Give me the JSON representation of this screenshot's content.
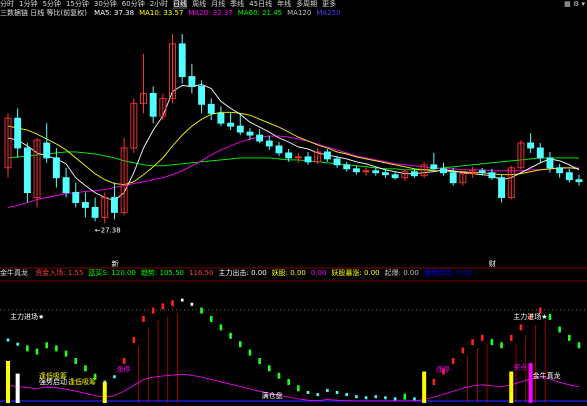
{
  "toolbar": {
    "items": [
      "分时",
      "1分钟",
      "5分钟",
      "15分钟",
      "30分钟",
      "60分钟",
      "2小时",
      "日线",
      "周线",
      "月线",
      "季线",
      "45日线",
      "年线",
      "多周期",
      "更多"
    ],
    "active_index": 7,
    "icons": [
      "chart-icon",
      "settings-icon",
      "dropdown-icon"
    ]
  },
  "main_panel": {
    "title": "三数据链 日线 等比(前复权)",
    "ma": [
      {
        "label": "MA5",
        "value": "37.38",
        "color": "#ffffff"
      },
      {
        "label": "MA10",
        "value": "33.57",
        "color": "#ffff00"
      },
      {
        "label": "MA20",
        "value": "32.37",
        "color": "#ff00ff"
      },
      {
        "label": "MA60",
        "value": "21.45",
        "color": "#00ff00"
      },
      {
        "label": "MA120",
        "value": "",
        "color": "#c0c0c0"
      },
      {
        "label": "MA250",
        "value": "",
        "color": "#4040ff"
      }
    ],
    "low_marker": "←27.38",
    "day_marker_left": "新",
    "day_marker_right": "财"
  },
  "indicator_panel": {
    "name": "金牛真龙",
    "items": [
      {
        "label": "资金入场",
        "value": "1.55",
        "color": "#ff4040"
      },
      {
        "label": "蓝买S",
        "value": "120.00",
        "color": "#00ff00"
      },
      {
        "label": "趋势",
        "value": "105.50",
        "color": "#00ff00"
      },
      {
        "label": "",
        "value": "116.50",
        "color": "#ff4040"
      },
      {
        "label": "主力出击",
        "value": "0.00",
        "color": "#ffffff"
      },
      {
        "label": "妖股",
        "value": "0.00",
        "color": "#ffff00"
      },
      {
        "label": "",
        "value": "0.00",
        "color": "#ff00ff"
      },
      {
        "label": "妖股暴涨",
        "value": "0.00",
        "color": "#ffff00"
      },
      {
        "label": "起爆",
        "value": "0.00",
        "color": "#c0c0c0"
      },
      {
        "label": "强势启动",
        "value": "0.00",
        "color": "#0000ff"
      }
    ],
    "annotations": [
      {
        "text": "主力进场★",
        "color": "#ffffff"
      },
      {
        "text": "强势启动",
        "color": "#ffffff"
      },
      {
        "text": "逢低吸筹",
        "color": "#ffff00"
      },
      {
        "text": "涨停",
        "color": "#ff00ff"
      },
      {
        "text": "满仓盘",
        "color": "#ffffff"
      },
      {
        "text": "逢低吸筹",
        "color": "#ffff00"
      },
      {
        "text": "涨停",
        "color": "#ff00ff"
      },
      {
        "text": "买点",
        "color": "#ff00ff"
      },
      {
        "text": "主力进场★",
        "color": "#ffffff"
      },
      {
        "text": "金牛真龙",
        "color": "#ffffff"
      }
    ]
  },
  "chart_data": [
    {
      "type": "candlestick",
      "title": "三数据链 日线",
      "colors": {
        "up": "#ff3333",
        "down": "#54ffff",
        "ma5": "#ffffff",
        "ma10": "#ffff00",
        "ma20": "#ff00ff",
        "ma60": "#00ff00"
      },
      "ylim": [
        24,
        47
      ],
      "candles": [
        [
          33,
          38.5,
          32,
          38
        ],
        [
          38,
          39,
          34,
          35
        ],
        [
          35,
          35.5,
          29.5,
          30.5
        ],
        [
          30,
          36,
          29,
          35.8
        ],
        [
          35.5,
          37.5,
          33.5,
          34
        ],
        [
          34,
          35,
          31,
          32
        ],
        [
          32,
          33,
          30,
          30.5
        ],
        [
          30.5,
          31.5,
          29,
          29.5
        ],
        [
          29.5,
          30.5,
          28,
          29
        ],
        [
          29,
          30,
          27.6,
          28
        ],
        [
          28,
          30.5,
          27.4,
          30
        ],
        [
          30,
          31.5,
          27.8,
          28.5
        ],
        [
          28.5,
          36,
          28.2,
          35
        ],
        [
          35,
          40,
          34.5,
          39.5
        ],
        [
          39.5,
          44.5,
          38.5,
          40.5
        ],
        [
          40.5,
          41.2,
          37.5,
          38.2
        ],
        [
          38.2,
          40.5,
          37.8,
          40
        ],
        [
          40,
          46.5,
          39.5,
          45.5
        ],
        [
          45.5,
          46.5,
          41.5,
          42.2
        ],
        [
          42.2,
          43.5,
          40.5,
          41.2
        ],
        [
          41.2,
          41.8,
          38.5,
          39.4
        ],
        [
          39.4,
          40,
          37.8,
          38.5
        ],
        [
          38.5,
          39.2,
          37.2,
          37.5
        ],
        [
          37.5,
          38.6,
          36.8,
          37.2
        ],
        [
          37.2,
          38.4,
          36.3,
          36.6
        ],
        [
          36.6,
          37,
          35.8,
          36.3
        ],
        [
          36.3,
          36.9,
          35.5,
          35.7
        ],
        [
          35.7,
          36.2,
          34.8,
          35.2
        ],
        [
          35.2,
          35.6,
          34.2,
          34.5
        ],
        [
          34.5,
          34.9,
          33.6,
          34
        ],
        [
          34,
          34.5,
          33.5,
          34.1
        ],
        [
          34.1,
          34.6,
          33.3,
          33.6
        ],
        [
          33.6,
          35,
          33.4,
          34.6
        ],
        [
          34.6,
          34.9,
          33.6,
          33.9
        ],
        [
          33.9,
          34.2,
          33,
          33.3
        ],
        [
          33.3,
          33.6,
          32.6,
          32.9
        ],
        [
          32.9,
          33.2,
          32.3,
          32.6
        ],
        [
          32.6,
          33,
          32.2,
          32.7
        ],
        [
          32.7,
          33,
          32.2,
          32.5
        ],
        [
          32.5,
          32.9,
          32,
          32.3
        ],
        [
          32.3,
          32.6,
          31.8,
          32
        ],
        [
          32,
          32.8,
          31.7,
          32.6
        ],
        [
          32.6,
          32.9,
          32,
          32.2
        ],
        [
          32.2,
          33.6,
          32,
          33.3
        ],
        [
          33.3,
          34.5,
          32.7,
          32.9
        ],
        [
          32.9,
          33.5,
          32.2,
          32.5
        ],
        [
          32.5,
          33,
          31.2,
          31.5
        ],
        [
          31.5,
          32.6,
          31.2,
          32.4
        ],
        [
          32.4,
          33.1,
          32,
          32.7
        ],
        [
          32.7,
          33,
          32.2,
          32.5
        ],
        [
          32.5,
          32.9,
          31.8,
          32
        ],
        [
          32,
          32.3,
          29.5,
          30
        ],
        [
          30,
          33.2,
          29.8,
          33
        ],
        [
          33,
          35.8,
          32.8,
          35.5
        ],
        [
          35.5,
          36.5,
          34.5,
          35
        ],
        [
          35,
          35.5,
          33.5,
          34
        ],
        [
          34,
          34.6,
          32.5,
          33
        ],
        [
          33,
          33.4,
          32,
          32.5
        ],
        [
          32.5,
          32.9,
          31.5,
          31.8
        ],
        [
          31.8,
          32.3,
          31.2,
          31.6
        ]
      ],
      "ma5": [
        36,
        35.8,
        35.2,
        34.5,
        34.2,
        33.9,
        33.4,
        32,
        31.2,
        30.5,
        30,
        29.7,
        30.5,
        32.5,
        35,
        36.8,
        38.2,
        40.7,
        41.3,
        41.2,
        41.4,
        41,
        39.7,
        39,
        38.4,
        37.6,
        37.1,
        36.6,
        36,
        35.6,
        35.1,
        34.9,
        34.5,
        34.3,
        34.1,
        33.9,
        33.6,
        33.4,
        33.1,
        32.8,
        32.6,
        32.4,
        32.4,
        32.5,
        32.6,
        32.8,
        32.7,
        32.5,
        32.4,
        32.3,
        32.2,
        31.8,
        32,
        32.5,
        33,
        33.5,
        33.9,
        33.7,
        33.3,
        32.8
      ],
      "ma10": [
        37.2,
        37,
        36.8,
        36.4,
        35.9,
        35.4,
        34.8,
        34,
        33.2,
        32.4,
        31.8,
        31.4,
        31.3,
        31.6,
        32.3,
        33.1,
        34,
        35.2,
        36.3,
        37.2,
        37.9,
        38.4,
        38.6,
        38.6,
        38.5,
        38.3,
        37.9,
        37.5,
        37.1,
        36.6,
        36.1,
        35.7,
        35.3,
        35,
        34.6,
        34.4,
        34.1,
        33.9,
        33.7,
        33.5,
        33.3,
        33.1,
        32.9,
        32.8,
        32.7,
        32.7,
        32.6,
        32.6,
        32.5,
        32.5,
        32.4,
        32.3,
        32.3,
        32.4,
        32.6,
        32.8,
        32.9,
        33,
        33,
        32.9
      ],
      "ma20": [
        29,
        29.2,
        29.5,
        29.8,
        30,
        30.2,
        30.4,
        30.5,
        30.6,
        30.7,
        30.8,
        31,
        31.2,
        31.4,
        31.6,
        31.8,
        32,
        32.3,
        32.7,
        33.2,
        33.7,
        34.3,
        34.8,
        35.2,
        35.6,
        35.9,
        36.1,
        36.2,
        36.2,
        36.1,
        35.9,
        35.7,
        35.4,
        35.1,
        34.8,
        34.5,
        34.2,
        34,
        33.8,
        33.6,
        33.4,
        33.3,
        33.2,
        33.1,
        33,
        32.9,
        32.9,
        32.8,
        32.8,
        32.8,
        32.7,
        32.7,
        32.7,
        32.7,
        32.8,
        32.8,
        32.9,
        32.9,
        33,
        33
      ],
      "ma60": [
        34,
        34.1,
        34.2,
        34.3,
        34.4,
        34.5,
        34.6,
        34.6,
        34.5,
        34.4,
        34.2,
        34,
        33.7,
        33.5,
        33.3,
        33.2,
        33.2,
        33.3,
        33.4,
        33.5,
        33.6,
        33.7,
        33.8,
        33.9,
        34,
        34,
        34,
        34,
        33.9,
        33.8,
        33.8,
        33.7,
        33.6,
        33.5,
        33.4,
        33.3,
        33.2,
        33.1,
        33,
        32.9,
        32.9,
        32.8,
        32.8,
        32.8,
        32.9,
        33,
        33.1,
        33.2,
        33.3,
        33.4,
        33.5,
        33.6,
        33.7,
        33.8,
        33.9,
        34,
        34,
        34,
        34,
        34
      ]
    },
    {
      "type": "bar",
      "title": "金牛真龙",
      "ylim": [
        0,
        100
      ],
      "trend": [
        [
          "cyan",
          60
        ],
        [
          "cyan",
          56
        ],
        [
          "green",
          52
        ],
        [
          "green",
          49
        ],
        [
          "green",
          55
        ],
        [
          "green",
          52
        ],
        [
          "green",
          47
        ],
        [
          "green",
          40
        ],
        [
          "green",
          33
        ],
        [
          "green",
          25
        ],
        [
          "cyan",
          20
        ],
        [
          "cyan",
          25
        ],
        [
          "red",
          40
        ],
        [
          "red",
          60
        ],
        [
          "red",
          80
        ],
        [
          "red",
          88
        ],
        [
          "red",
          92
        ],
        [
          "red",
          95
        ],
        [
          "white",
          98
        ],
        [
          "white",
          94
        ],
        [
          "green",
          88
        ],
        [
          "green",
          80
        ],
        [
          "green",
          72
        ],
        [
          "green",
          64
        ],
        [
          "green",
          56
        ],
        [
          "green",
          48
        ],
        [
          "green",
          40
        ],
        [
          "green",
          33
        ],
        [
          "green",
          26
        ],
        [
          "green",
          20
        ],
        [
          "green",
          14
        ],
        [
          "cyan",
          10
        ],
        [
          "cyan",
          8
        ],
        [
          "cyan",
          12
        ],
        [
          "cyan",
          10
        ],
        [
          "cyan",
          8
        ],
        [
          "cyan",
          6
        ],
        [
          "cyan",
          5
        ],
        [
          "cyan",
          6
        ],
        [
          "cyan",
          5
        ],
        [
          "cyan",
          4
        ],
        [
          "green",
          6
        ],
        [
          "cyan",
          4
        ],
        [
          "red",
          12
        ],
        [
          "red",
          20
        ],
        [
          "red",
          30
        ],
        [
          "red",
          40
        ],
        [
          "red",
          50
        ],
        [
          "red",
          58
        ],
        [
          "red",
          62
        ],
        [
          "green",
          58
        ],
        [
          "green",
          55
        ],
        [
          "red",
          62
        ],
        [
          "red",
          72
        ],
        [
          "red",
          82
        ],
        [
          "red",
          88
        ],
        [
          "green",
          82
        ],
        [
          "green",
          70
        ],
        [
          "green",
          62
        ],
        [
          "green",
          55
        ]
      ],
      "columns": [
        {
          "index": 0,
          "value": 40,
          "color": "yellow"
        },
        {
          "index": 1,
          "value": 28,
          "color": "white"
        },
        {
          "index": 10,
          "value": 20,
          "color": "yellow"
        },
        {
          "index": 43,
          "value": 30,
          "color": "yellow"
        },
        {
          "index": 52,
          "value": 30,
          "color": "yellow"
        },
        {
          "index": 54,
          "value": 38,
          "color": "magenta"
        }
      ]
    }
  ]
}
